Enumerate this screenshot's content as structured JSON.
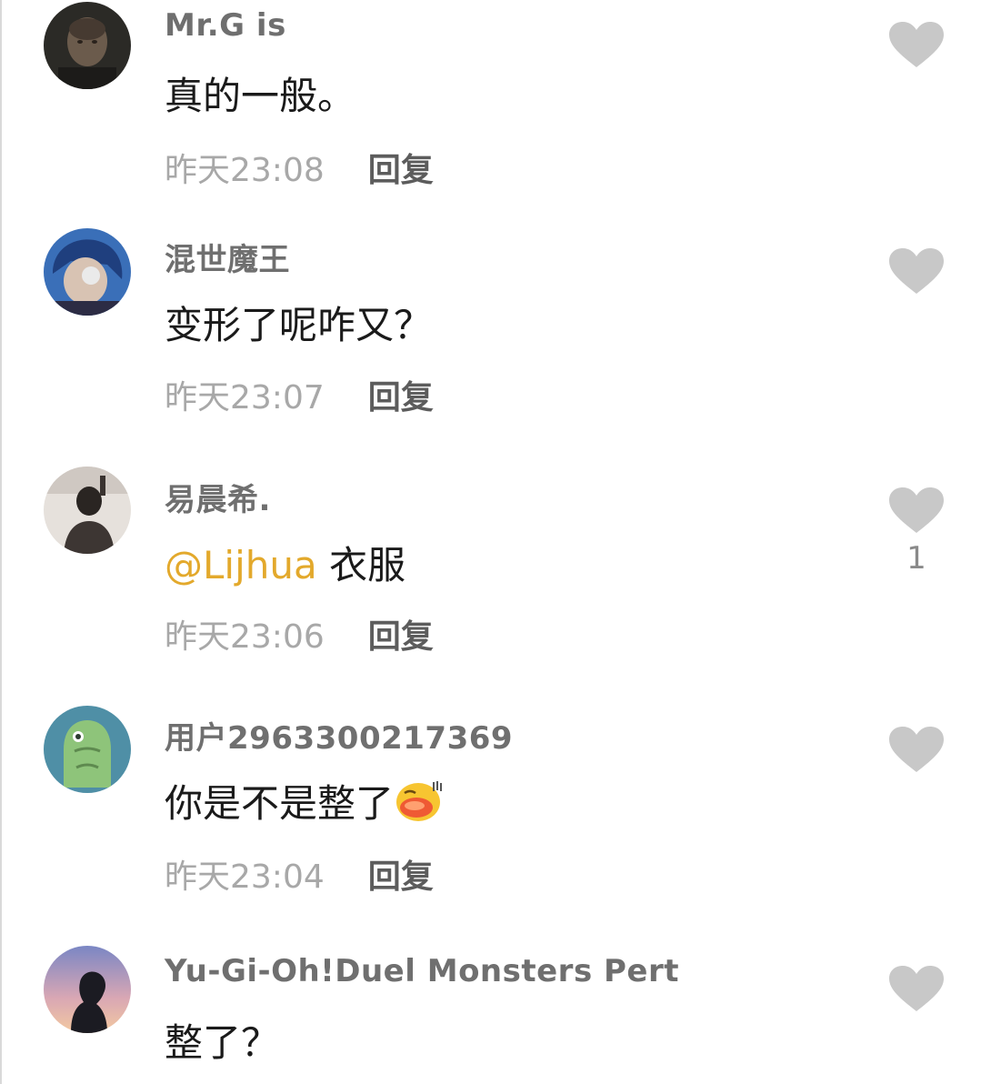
{
  "comments": [
    {
      "username": "Mr.G is",
      "text": "真的一般。",
      "time": "昨天23:08",
      "reply_label": "回复",
      "like_count": ""
    },
    {
      "username": "混世魔王",
      "text": "变形了呢咋又？",
      "time": "昨天23:07",
      "reply_label": "回复",
      "like_count": ""
    },
    {
      "username": "易晨希.",
      "mention": "@Lijhua",
      "text": " 衣服",
      "time": "昨天23:06",
      "reply_label": "回复",
      "like_count": "1"
    },
    {
      "username": "用户2963300217369",
      "text": "你是不是整了",
      "emoji": "embarrassed-face-emoji",
      "time": "昨天23:04",
      "reply_label": "回复",
      "like_count": ""
    },
    {
      "username": "Yu-Gi-Oh!Duel Monsters Pert",
      "text": "整了？",
      "like_count": ""
    }
  ],
  "colors": {
    "username": "#6f6f6f",
    "time": "#a8a8a8",
    "reply": "#5c5c5c",
    "mention": "#e3a92c",
    "heart": "#c8c8c8"
  },
  "icons": {
    "like": "heart-icon"
  }
}
